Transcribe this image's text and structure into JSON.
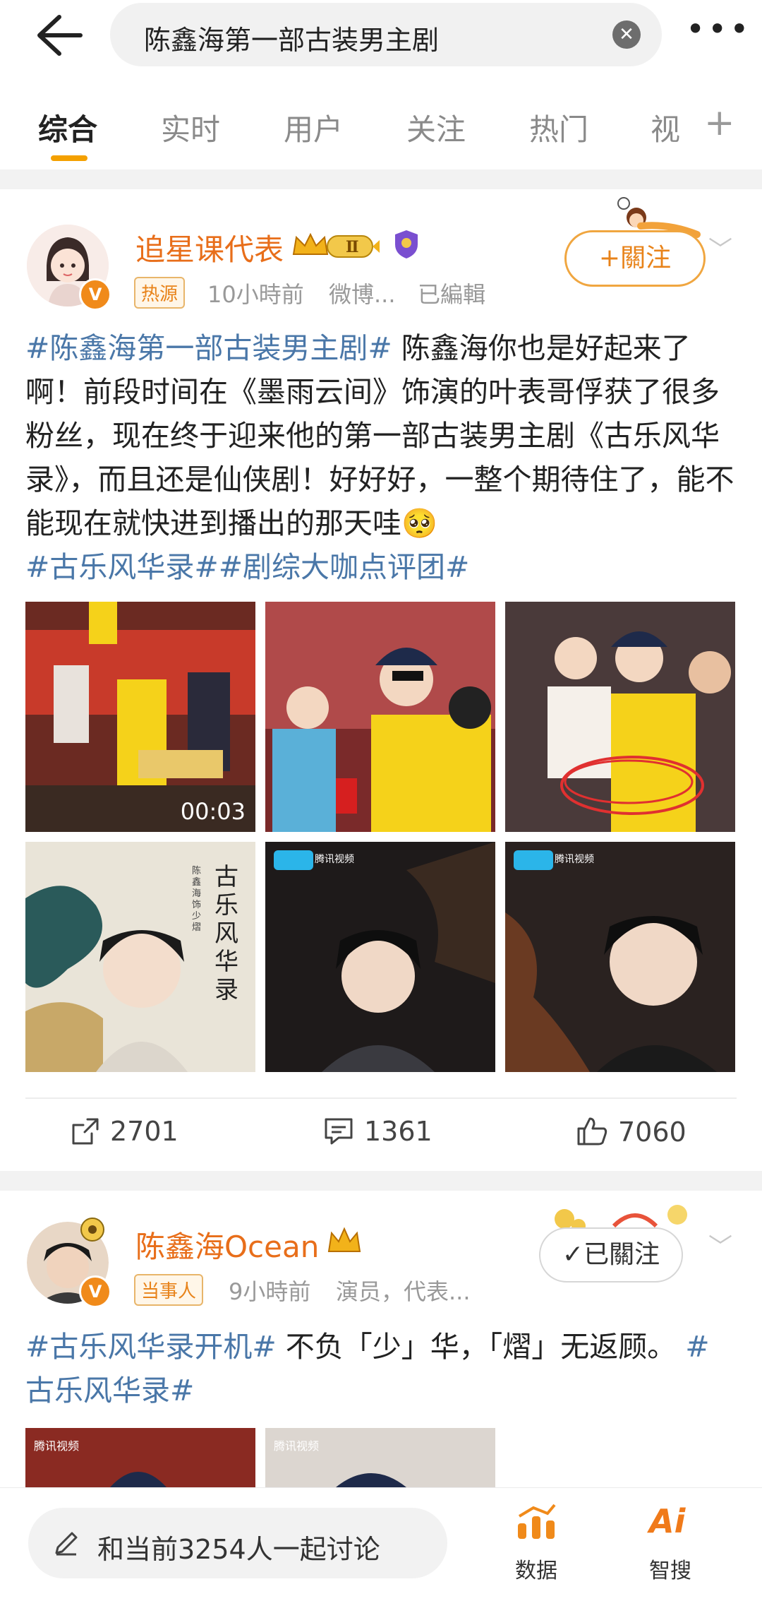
{
  "search": {
    "query": "陈鑫海第一部古装男主剧"
  },
  "tabs": [
    {
      "label": "综合"
    },
    {
      "label": "实时"
    },
    {
      "label": "用户"
    },
    {
      "label": "关注"
    },
    {
      "label": "热门"
    },
    {
      "label": "视"
    }
  ],
  "posts": [
    {
      "author": "追星课代表",
      "level_badge": "Ⅱ",
      "source_badge": "热源",
      "time": "10小時前",
      "via": "微博...",
      "edited": "已編輯",
      "follow_label": "+關注",
      "text_parts": [
        {
          "text": "#陈鑫海第一部古装男主剧#",
          "tag": true
        },
        {
          "text": " 陈鑫海你也是好起来了啊！前段时间在《墨雨云间》饰演的叶表哥俘获了很多粉丝，现在终于迎来他的第一部古装男主剧《古乐风华录》，而且还是仙侠剧！好好好，一整个期待住了，能不能现在就快进到播出的那天哇",
          "tag": false
        },
        {
          "text": "🥺",
          "tag": false
        },
        {
          "text": "#古乐风华录##剧综大咖点评团#",
          "tag": true
        }
      ],
      "video_duration": "00:03",
      "poster_title": "古乐风华录",
      "poster_cast": "陈鑫海 饰 少熠",
      "tencent_label": "腾讯视频",
      "shares": "2701",
      "comments": "1361",
      "likes": "7060"
    },
    {
      "author": "陈鑫海Ocean",
      "source_badge": "当事人",
      "time": "9小時前",
      "bio": "演员，代表...",
      "follow_label": "已關注",
      "text_parts": [
        {
          "text": "#古乐风华录开机#",
          "tag": true
        },
        {
          "text": " 不负「少」华，「熠」无返顾。",
          "tag": false
        },
        {
          "text": "#古乐风华录#",
          "tag": true
        }
      ],
      "tencent_label": "腾讯视频"
    }
  ],
  "bottom": {
    "discuss_placeholder": "和当前3254人一起讨论",
    "data_label": "数据",
    "ai_label": "智搜",
    "ai_icon_text": "Ai"
  },
  "colors": {
    "accent": "#f4a000",
    "name": "#e86e1a",
    "tag": "#4a77a8"
  }
}
